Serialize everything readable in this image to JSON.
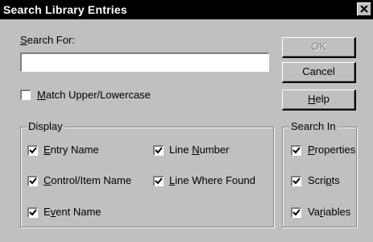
{
  "window": {
    "title": "Search Library Entries",
    "close_label": "×"
  },
  "search": {
    "label_prefix": "",
    "label_key": "S",
    "label_rest": "earch For:",
    "value": ""
  },
  "match_case": {
    "checked": false,
    "label_key": "M",
    "label_rest": "atch Upper/Lowercase"
  },
  "buttons": {
    "ok": "OK",
    "cancel": "Cancel",
    "help_key": "H",
    "help_rest": "elp"
  },
  "display_group": {
    "caption": "Display",
    "items": [
      {
        "pre": "",
        "key": "E",
        "rest": "ntry Name",
        "checked": true
      },
      {
        "pre": "Line ",
        "key": "N",
        "rest": "umber",
        "checked": true
      },
      {
        "pre": "",
        "key": "C",
        "rest": "ontrol/Item Name",
        "checked": true
      },
      {
        "pre": "",
        "key": "L",
        "rest": "ine Where Found",
        "checked": true
      },
      {
        "pre": "E",
        "key": "v",
        "rest": "ent Name",
        "checked": true
      }
    ]
  },
  "search_in_group": {
    "caption": "Search In",
    "items": [
      {
        "pre": "",
        "key": "P",
        "rest": "roperties",
        "checked": true
      },
      {
        "pre": "Scri",
        "key": "p",
        "rest": "ts",
        "checked": true
      },
      {
        "pre": "Va",
        "key": "r",
        "rest": "iables",
        "checked": true
      }
    ]
  }
}
